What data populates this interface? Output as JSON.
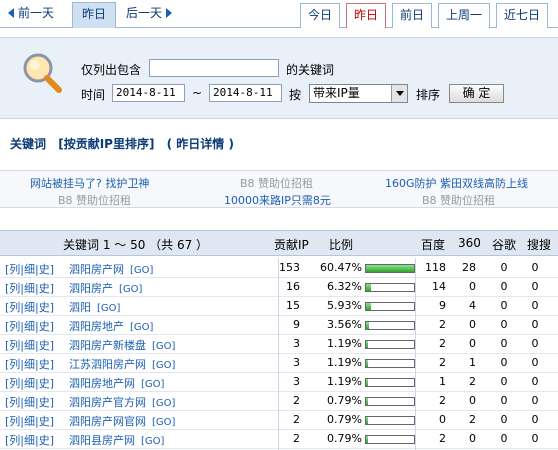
{
  "nav": {
    "prev_label": "前一天",
    "current_label": "昨日",
    "next_label": "后一天",
    "tabs": [
      {
        "label": "今日",
        "active": false
      },
      {
        "label": "昨日",
        "active": true
      },
      {
        "label": "前日",
        "active": false
      },
      {
        "label": "上周一",
        "active": false
      },
      {
        "label": "近七日",
        "active": false
      }
    ]
  },
  "filter": {
    "contains_label": "仅列出包含",
    "keyword_value": "",
    "keyword_suffix": "的关键词",
    "time_label": "时间",
    "date_from": "2014-8-11",
    "tilde": "~",
    "date_to": "2014-8-11",
    "by_label": "按",
    "sort_select": "带来IP量",
    "sort_label": "排序",
    "confirm_label": "确 定"
  },
  "headline": {
    "keyword": "关键词",
    "sort_by": "[按贡献IP里排序]",
    "yesterday_detail": "( 昨日详情 )"
  },
  "ads": {
    "ad1": "网站被挂马了? 找护卫神",
    "ad2": "B8 赞助位招租",
    "ad3": "160G防护 紫田双线高防上线",
    "ad4": "B8 赞助位招租",
    "ad5": "10000来路IP只需8元",
    "ad6": "B8 赞助位招租"
  },
  "table": {
    "headers": {
      "keyword_range": "关键词 1 ～ 50 （共 67 ）",
      "contrib_ip": "贡献IP",
      "ratio": "比例",
      "baidu": "百度",
      "s360": "360",
      "google": "谷歌",
      "sogou": "搜搜"
    },
    "row_links": "[列|细|史]",
    "go_label": "[GO]",
    "rows": [
      {
        "keyword": "泗阳房产网",
        "ip": "153",
        "pct": "60.47%",
        "ratio": 0.6047,
        "baidu": "118",
        "s360": "28",
        "google": "0",
        "sogou": "0"
      },
      {
        "keyword": "泗阳房产",
        "ip": "16",
        "pct": "6.32%",
        "ratio": 0.0632,
        "baidu": "14",
        "s360": "0",
        "google": "0",
        "sogou": "0"
      },
      {
        "keyword": "泗阳",
        "ip": "15",
        "pct": "5.93%",
        "ratio": 0.0593,
        "baidu": "9",
        "s360": "4",
        "google": "0",
        "sogou": "0"
      },
      {
        "keyword": "泗阳房地产",
        "ip": "9",
        "pct": "3.56%",
        "ratio": 0.0356,
        "baidu": "2",
        "s360": "0",
        "google": "0",
        "sogou": "0"
      },
      {
        "keyword": "泗阳房产新楼盘",
        "ip": "3",
        "pct": "1.19%",
        "ratio": 0.0119,
        "baidu": "2",
        "s360": "0",
        "google": "0",
        "sogou": "0"
      },
      {
        "keyword": "江苏泗阳房产网",
        "ip": "3",
        "pct": "1.19%",
        "ratio": 0.0119,
        "baidu": "2",
        "s360": "1",
        "google": "0",
        "sogou": "0"
      },
      {
        "keyword": "泗阳房地产网",
        "ip": "3",
        "pct": "1.19%",
        "ratio": 0.0119,
        "baidu": "1",
        "s360": "2",
        "google": "0",
        "sogou": "0"
      },
      {
        "keyword": "泗阳房产官方网",
        "ip": "2",
        "pct": "0.79%",
        "ratio": 0.0079,
        "baidu": "2",
        "s360": "0",
        "google": "0",
        "sogou": "0"
      },
      {
        "keyword": "泗阳房产网官网",
        "ip": "2",
        "pct": "0.79%",
        "ratio": 0.0079,
        "baidu": "0",
        "s360": "2",
        "google": "0",
        "sogou": "0"
      },
      {
        "keyword": "泗阳县房产网",
        "ip": "2",
        "pct": "0.79%",
        "ratio": 0.0079,
        "baidu": "2",
        "s360": "0",
        "google": "0",
        "sogou": "0"
      }
    ]
  }
}
